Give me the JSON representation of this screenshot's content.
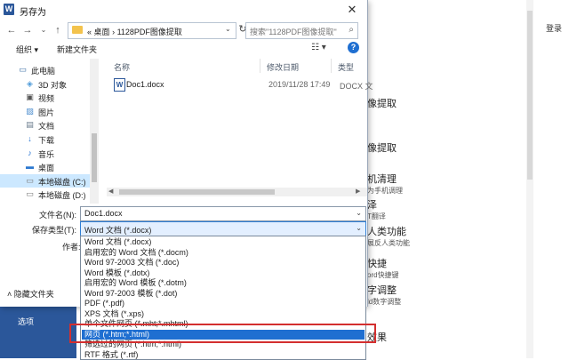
{
  "app": {
    "signin": "登录",
    "options": "选项",
    "right_items": [
      {
        "title": "像提取",
        "sub": ""
      },
      {
        "title": "像提取",
        "sub": ""
      },
      {
        "title": "机清理",
        "sub": "为手机调理"
      },
      {
        "title": "泽",
        "sub": "T翻译"
      },
      {
        "title": "人类功能",
        "sub": "展反人类功能"
      },
      {
        "title": "快捷",
        "sub": "ord快捷键"
      },
      {
        "title": "字调整",
        "sub": "ld数字调整"
      },
      {
        "title": "效果",
        "sub": ""
      }
    ]
  },
  "dialog": {
    "title": "另存为",
    "close_icon": "close-icon",
    "breadcrumb": [
      "«",
      "桌面",
      "›",
      "1128PDF图像提取"
    ],
    "search_placeholder": "搜索\"1128PDF图像提取\"",
    "organize": "组织 ▾",
    "new_folder": "新建文件夹",
    "view": "☷ ▾",
    "help": "?",
    "nav_items": [
      {
        "label": "此电脑",
        "icon": "computer-icon",
        "indent": 0
      },
      {
        "label": "3D 对象",
        "icon": "3d-objects-icon",
        "indent": 1
      },
      {
        "label": "视频",
        "icon": "video-icon",
        "indent": 1
      },
      {
        "label": "图片",
        "icon": "pictures-icon",
        "indent": 1
      },
      {
        "label": "文档",
        "icon": "documents-icon",
        "indent": 1
      },
      {
        "label": "下载",
        "icon": "download-icon",
        "indent": 1
      },
      {
        "label": "音乐",
        "icon": "music-icon",
        "indent": 1
      },
      {
        "label": "桌面",
        "icon": "desktop-icon",
        "indent": 1
      },
      {
        "label": "本地磁盘 (C:)",
        "icon": "drive-icon",
        "indent": 1
      },
      {
        "label": "本地磁盘 (D:)",
        "icon": "drive-icon",
        "indent": 1
      }
    ],
    "columns": {
      "name": "名称",
      "date": "修改日期",
      "type": "类型"
    },
    "files": [
      {
        "name": "Doc1.docx",
        "date": "2019/11/28 17:49",
        "type": "DOCX 文"
      }
    ],
    "filename_label": "文件名(N):",
    "filename_value": "Doc1.docx",
    "savetype_label": "保存类型(T):",
    "savetype_value": "Word 文档 (*.docx)",
    "author_label": "作者:",
    "hide_folders": "隐藏文件夹",
    "type_options": [
      "Word 文档 (*.docx)",
      "启用宏的 Word 文档 (*.docm)",
      "Word 97-2003 文档 (*.doc)",
      "Word 模板 (*.dotx)",
      "启用宏的 Word 模板 (*.dotm)",
      "Word 97-2003 模板 (*.dot)",
      "PDF (*.pdf)",
      "XPS 文档 (*.xps)",
      "单个文件网页 (*.mht;*.mhtml)",
      "网页 (*.htm;*.html)",
      "筛选过的网页 (*.htm;*.html)",
      "RTF 格式 (*.rtf)"
    ],
    "highlighted_option": "网页 (*.htm;*.html)"
  }
}
